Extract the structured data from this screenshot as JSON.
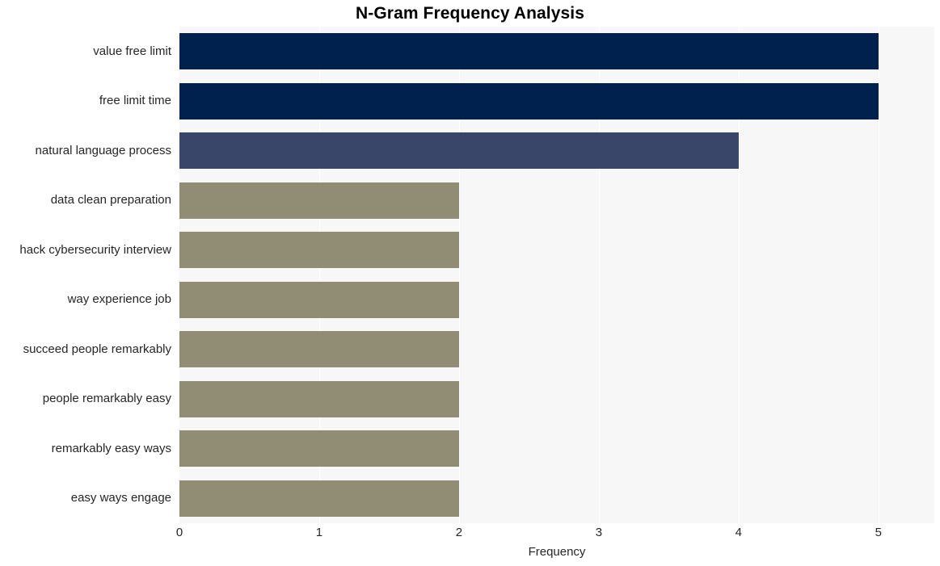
{
  "chart_data": {
    "type": "bar",
    "orientation": "horizontal",
    "title": "N-Gram Frequency Analysis",
    "xlabel": "Frequency",
    "ylabel": "",
    "categories": [
      "value free limit",
      "free limit time",
      "natural language process",
      "data clean preparation",
      "hack cybersecurity interview",
      "way experience job",
      "succeed people remarkably",
      "people remarkably easy",
      "remarkably easy ways",
      "easy ways engage"
    ],
    "values": [
      5,
      5,
      4,
      2,
      2,
      2,
      2,
      2,
      2,
      2
    ],
    "bar_colors": [
      "#00204e",
      "#00204e",
      "#3a4669",
      "#918c74",
      "#918c74",
      "#918c74",
      "#918c74",
      "#918c74",
      "#918c74",
      "#918c74"
    ],
    "xlim": [
      0,
      5.4
    ],
    "xticks": [
      0,
      1,
      2,
      3,
      4,
      5
    ],
    "xtick_labels": [
      "0",
      "1",
      "2",
      "3",
      "4",
      "5"
    ],
    "grid": "vertical",
    "gridline_color": "#ffffff",
    "plot_background": "#f7f7f7",
    "figure_background": "#ffffff",
    "legend": null
  },
  "style": {
    "title_color": "#000000",
    "tick_label_color": "#262626",
    "axis_label_color": "#262626"
  }
}
